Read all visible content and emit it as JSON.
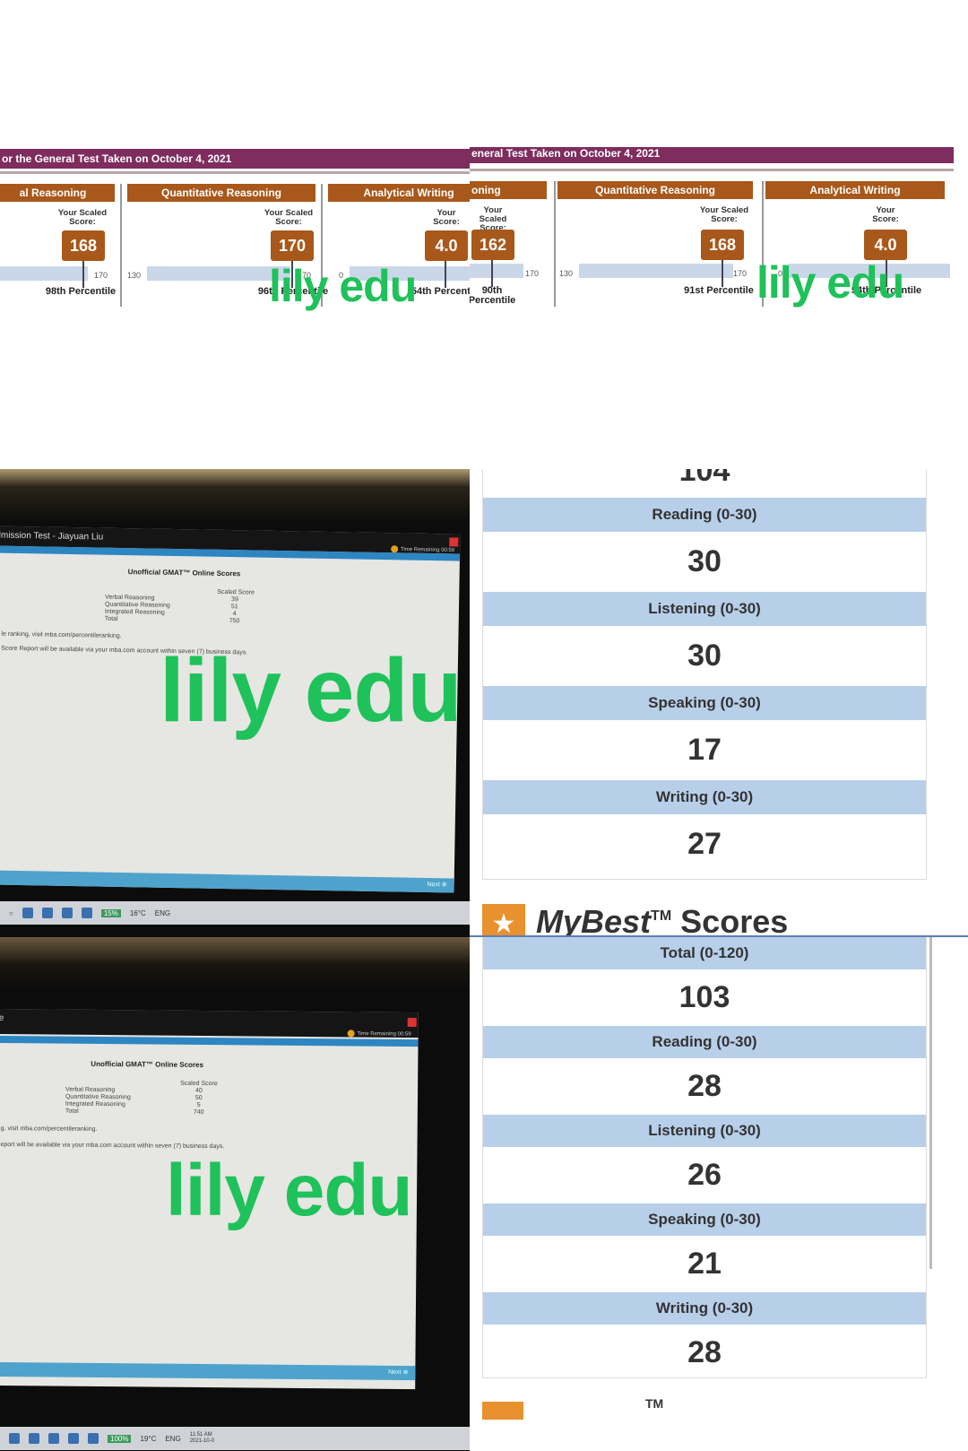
{
  "watermark": "lily edu",
  "gre_left": {
    "banner": "or the General Test Taken on October 4, 2021",
    "verbal": {
      "title": "al Reasoning",
      "label": "Your Scaled Score:",
      "score": "168",
      "max": "170",
      "percentile": "98th Percentile"
    },
    "quant": {
      "title": "Quantitative Reasoning",
      "label": "Your Scaled Score:",
      "score": "170",
      "min": "130",
      "max": "170",
      "percentile": "96th Percentile"
    },
    "writing": {
      "title": "Analytical Writing",
      "label": "Your Score:",
      "score": "4.0",
      "min": "0",
      "percentile": "54th Percentile"
    }
  },
  "gre_right": {
    "banner": "eneral Test Taken on October 4, 2021",
    "verbal": {
      "title": "oning",
      "label": "Your Scaled Score:",
      "score": "162",
      "max": "170",
      "percentile": "90th Percentile"
    },
    "quant": {
      "title": "Quantitative Reasoning",
      "label": "Your Scaled Score:",
      "score": "168",
      "min": "130",
      "max": "170",
      "percentile": "91st Percentile"
    },
    "writing": {
      "title": "Analytical Writing",
      "label": "Your Score:",
      "score": "4.0",
      "min": "0",
      "percentile": "54th Percentile"
    }
  },
  "gmat1": {
    "window_title": "dmission Test - Jiayuan Liu",
    "timer": "Time Remaining 00:58",
    "heading": "Unofficial GMAT™ Online Scores",
    "col_header": "Scaled Score",
    "rows": [
      {
        "name": "Verbal Reasoning",
        "score": "39"
      },
      {
        "name": "Quantitative Reasoning",
        "score": "51"
      },
      {
        "name": "Integrated Reasoning",
        "score": "4"
      },
      {
        "name": "Total",
        "score": "750"
      }
    ],
    "note1": "le ranking, visit mba.com/percentileranking.",
    "note2": "Score Report will be available via your mba.com account within seven (7) business days.",
    "next": "Next",
    "taskbar": {
      "percent": "15%",
      "weather": "16°C",
      "lang": "ENG"
    }
  },
  "gmat2": {
    "window_title": "Te",
    "timer": "Time Remaining 00:59",
    "heading": "Unofficial GMAT™ Online Scores",
    "col_header": "Scaled Score",
    "rows": [
      {
        "name": "Verbal Reasoning",
        "score": "40"
      },
      {
        "name": "Quantitative Reasoning",
        "score": "50"
      },
      {
        "name": "Integrated Reasoning",
        "score": "5"
      },
      {
        "name": "Total",
        "score": "740"
      }
    ],
    "note1": "g, visit mba.com/percentileranking.",
    "note2": "eport will be available via your mba.com account within seven (7) business days.",
    "next": "Next",
    "taskbar": {
      "percent": "100%",
      "weather": "19°C",
      "lang": "ENG",
      "time": "11:51 AM",
      "date": "2021-10-0"
    }
  },
  "toefl": {
    "top_total_partial": "104",
    "first": [
      {
        "cat": "Reading (0-30)",
        "val": "30"
      },
      {
        "cat": "Listening (0-30)",
        "val": "30"
      },
      {
        "cat": "Speaking (0-30)",
        "val": "17"
      },
      {
        "cat": "Writing (0-30)",
        "val": "27"
      }
    ],
    "mybest": {
      "my": "MyBest",
      "tm": "TM",
      "scores": "Scores"
    },
    "second": [
      {
        "cat": "Total (0-120)",
        "val": "103"
      },
      {
        "cat": "Reading (0-30)",
        "val": "28"
      },
      {
        "cat": "Listening (0-30)",
        "val": "26"
      },
      {
        "cat": "Speaking (0-30)",
        "val": "21"
      },
      {
        "cat": "Writing (0-30)",
        "val": "28"
      }
    ],
    "bottom_tm": "TM"
  }
}
